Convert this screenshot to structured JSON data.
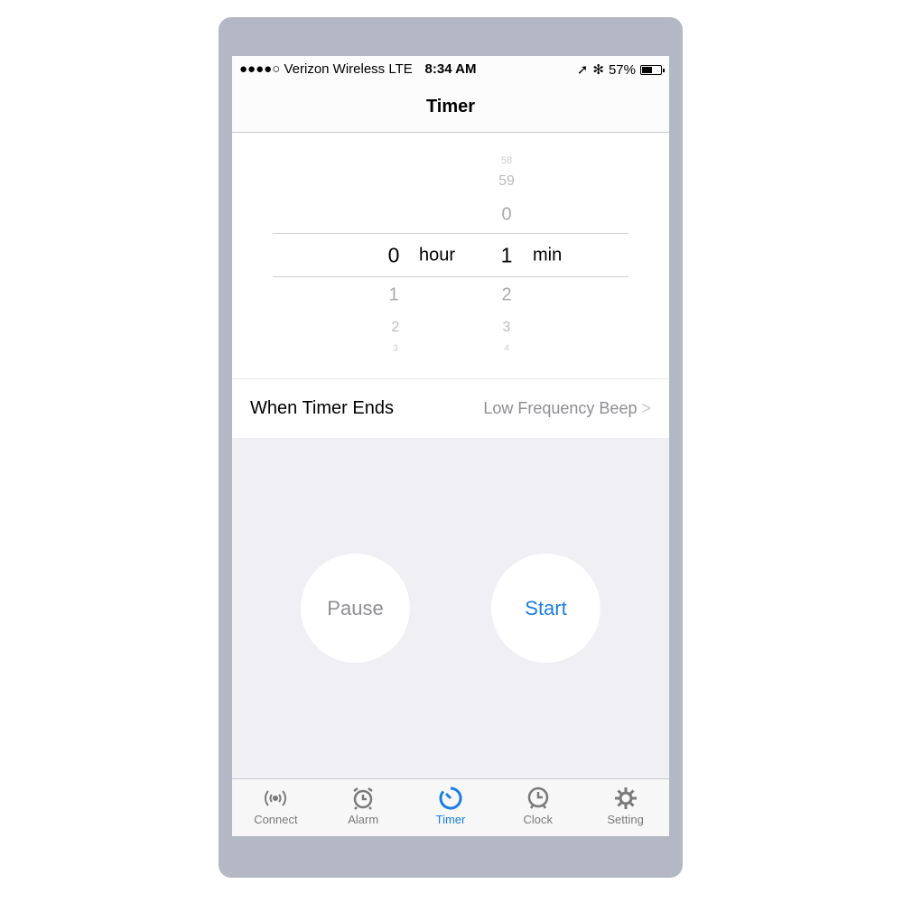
{
  "status": {
    "carrier": "●●●●○ Verizon Wireless  LTE",
    "time": "8:34 AM",
    "battery": "57%",
    "battery_level": 0.57
  },
  "nav": {
    "title": "Timer"
  },
  "picker": {
    "hour": {
      "above": [
        "",
        ""
      ],
      "selected": "0",
      "below": [
        "1",
        "2",
        "3"
      ],
      "unit": "hour"
    },
    "minute": {
      "above": [
        "58",
        "59",
        "0"
      ],
      "selected": "1",
      "below": [
        "2",
        "3",
        "4"
      ],
      "unit": "min"
    }
  },
  "setting": {
    "label": "When Timer Ends",
    "value": "Low Frequency Beep"
  },
  "buttons": {
    "pause": "Pause",
    "start": "Start"
  },
  "tabs": [
    {
      "label": "Connect",
      "icon": "broadcast-icon"
    },
    {
      "label": "Alarm",
      "icon": "alarm-clock-icon"
    },
    {
      "label": "Timer",
      "icon": "timer-icon",
      "active": true
    },
    {
      "label": "Clock",
      "icon": "clock-icon"
    },
    {
      "label": "Setting",
      "icon": "gear-icon"
    }
  ],
  "colors": {
    "accent": "#1a7ee5",
    "background": "#efeff4",
    "frame": "#b4b8c4"
  }
}
